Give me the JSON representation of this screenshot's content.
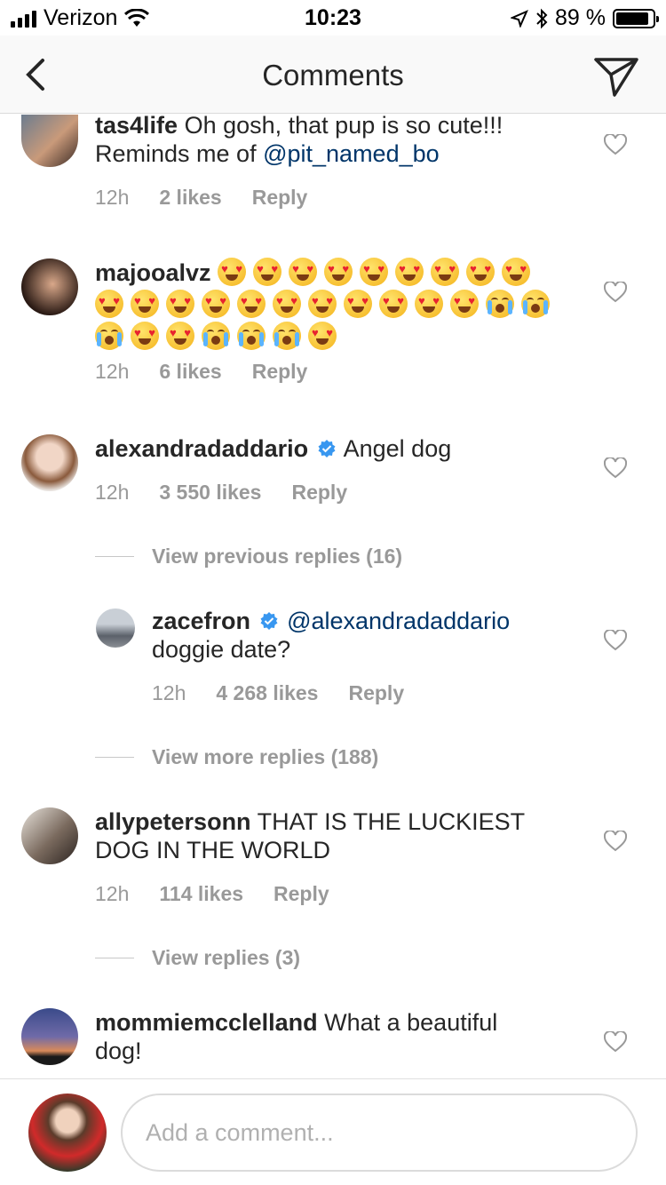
{
  "status_bar": {
    "carrier": "Verizon",
    "time": "10:23",
    "battery_percent": "89 %",
    "battery_level": 0.89
  },
  "nav": {
    "title": "Comments"
  },
  "comments": [
    {
      "username": "tas4life",
      "text": "Oh gosh, that pup is so cute!!!",
      "text_line2_prefix": "Reminds me of",
      "mention": "@pit_named_bo",
      "time": "12h",
      "likes": "2 likes",
      "reply": "Reply"
    },
    {
      "username": "majooalvz",
      "emoji_line1": [
        "love",
        "love",
        "love",
        "love",
        "love",
        "love",
        "love",
        "love",
        "love"
      ],
      "emoji_line2": [
        "love",
        "love",
        "love",
        "love",
        "love",
        "love",
        "love",
        "love",
        "love",
        "love",
        "love",
        "cry",
        "cry"
      ],
      "emoji_line3": [
        "cry",
        "love",
        "love",
        "cry",
        "cry",
        "cry",
        "love"
      ],
      "time": "12h",
      "likes": "6 likes",
      "reply": "Reply"
    },
    {
      "username": "alexandradaddario",
      "verified": true,
      "text": "Angel dog",
      "time": "12h",
      "likes": "3 550 likes",
      "reply": "Reply",
      "view_replies": "View previous replies (16)"
    },
    {
      "username": "zacefron",
      "verified": true,
      "mention": "@alexandradaddario",
      "text": "doggie date?",
      "time": "12h",
      "likes": "4 268 likes",
      "reply": "Reply",
      "view_replies": "View more replies (188)"
    },
    {
      "username": "allypetersonn",
      "text_line1": "THAT IS THE LUCKIEST",
      "text_line2": "DOG IN THE WORLD",
      "time": "12h",
      "likes": "114 likes",
      "reply": "Reply",
      "view_replies": "View replies (3)"
    },
    {
      "username": "mommiemcclelland",
      "text_line1": "What a beautiful",
      "text_line2": "dog!"
    }
  ],
  "input": {
    "placeholder": "Add a comment..."
  },
  "icons": {
    "back": "chevron-left-icon",
    "send": "paper-plane-icon",
    "like": "heart-outline-icon",
    "verified": "verified-badge-icon"
  },
  "colors": {
    "mention": "#003569",
    "meta": "#999999",
    "verified": "#3897f0"
  }
}
